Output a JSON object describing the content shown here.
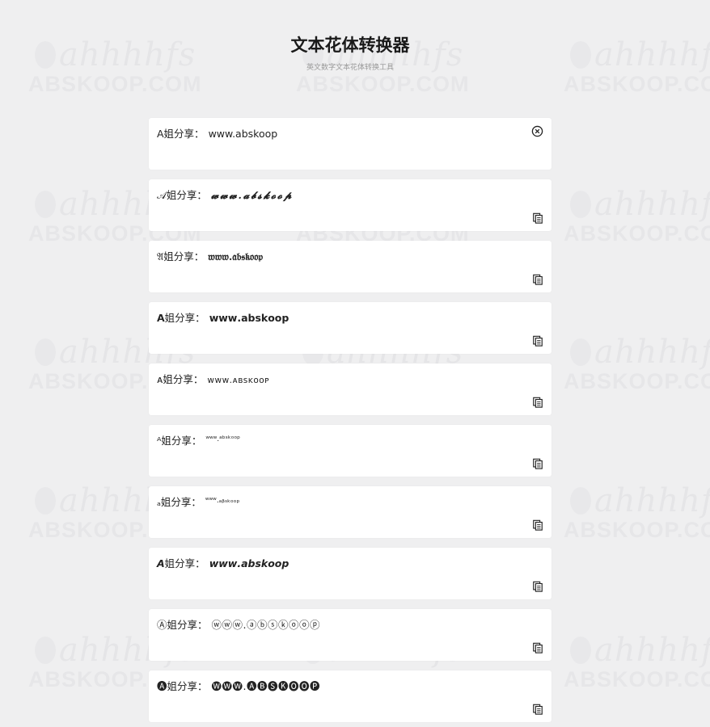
{
  "header": {
    "title": "文本花体转换器",
    "subtitle": "英文数字文本花体转换工具"
  },
  "watermark": {
    "top_text": "ahhhhfs",
    "bottom_text": "ABSKOOP.COM"
  },
  "input": {
    "prefix": "A姐分享：",
    "value": "www.abskoop",
    "clear_icon": "circle-x-icon"
  },
  "results": [
    {
      "prefix": "𝒜姐分享：",
      "value": "𝔀𝔀𝔀.𝓪𝓫𝓼𝓴𝓸𝓸𝓹",
      "style": "script"
    },
    {
      "prefix": "𝔄姐分享：",
      "value": "𝔴𝔴𝔴.𝔞𝔟𝔰𝔨𝔬𝔬𝔭",
      "style": "fraktur"
    },
    {
      "prefix": "𝗔姐分享：",
      "value": "𝘄𝘄𝘄.𝗮𝗯𝘀𝗸𝗼𝗼𝗽",
      "style": "bold-sans"
    },
    {
      "prefix": "ᴀ姐分享：",
      "value": "ᴡᴡᴡ.ᴀʙsᴋᴏᴏᴘ",
      "style": "small-caps"
    },
    {
      "prefix": "ᴬ姐分享：",
      "value": "ʷʷʷ.ᵃᵇˢᵏᵒᵒᵖ",
      "style": "superscript"
    },
    {
      "prefix": "ₐ姐分享：",
      "value": "ʷʷʷ.ₐᵦₛₖₒₒₚ",
      "style": "subscript"
    },
    {
      "prefix": "𝘼姐分享：",
      "value": "𝙬𝙬𝙬.𝙖𝙗𝙨𝙠𝙤𝙤𝙥",
      "style": "bold-italic"
    },
    {
      "prefix": "Ⓐ姐分享：",
      "value": "ⓦⓦⓦ.ⓐⓑⓢⓚⓞⓞⓟ",
      "style": "circled"
    },
    {
      "prefix": "🅐姐分享：",
      "value": "🅦🅦🅦.🅐🅑🅢🅚🅞🅞🅟",
      "style": "circled-filled"
    }
  ],
  "copy_icon": "copy-icon",
  "colors": {
    "background": "#efeff0",
    "card": "#ffffff",
    "text": "#222222",
    "watermark": "#dcdcdf"
  }
}
